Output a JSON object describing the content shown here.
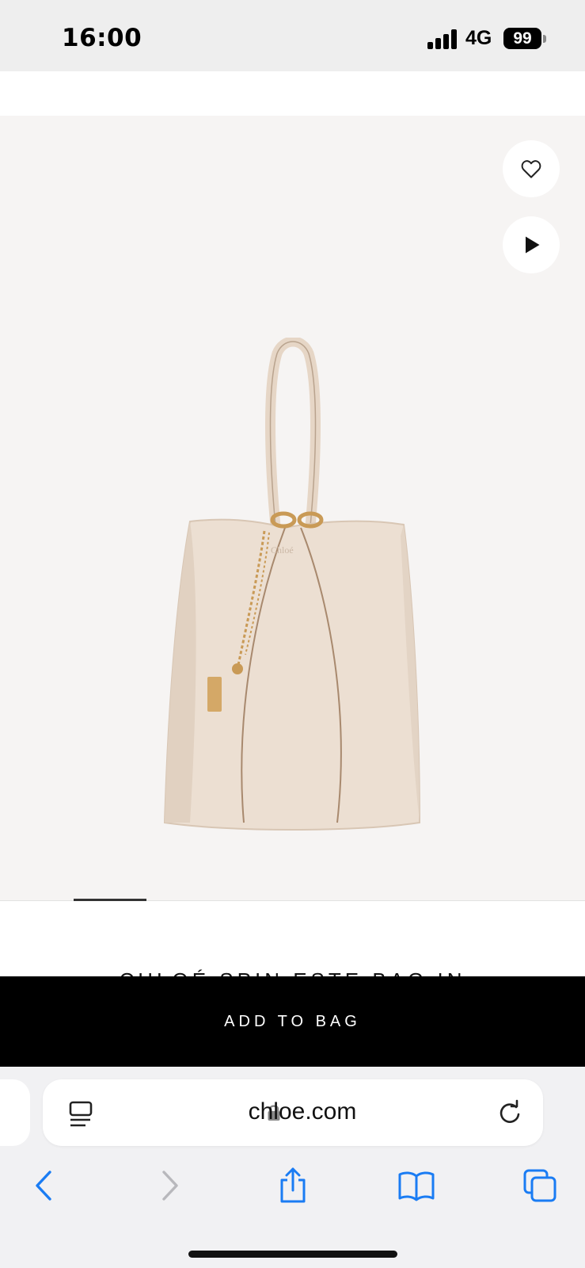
{
  "status": {
    "time": "16:00",
    "network": "4G",
    "battery": "99"
  },
  "product": {
    "title": "CHLOÉ SPIN ESTE BAG IN",
    "add_to_bag": "ADD TO BAG",
    "bag_logo": "Chloé",
    "colors": {
      "leather": "#ecdfd2",
      "hardware": "#c99a56",
      "background": "#f6f4f3"
    }
  },
  "actions": {
    "wishlist_icon": "heart-icon",
    "video_icon": "play-icon"
  },
  "gallery": {
    "slides_indicator": "1"
  },
  "browser": {
    "url": "chloe.com",
    "nav": [
      "back-icon",
      "forward-icon",
      "share-icon",
      "bookmarks-icon",
      "tabs-icon"
    ],
    "accent": "#1a7cf3"
  }
}
